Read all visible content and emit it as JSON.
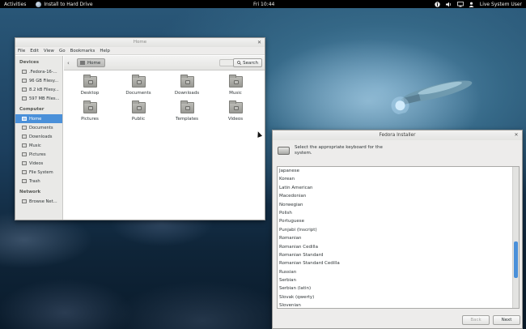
{
  "topbar": {
    "activities": "Activities",
    "app_name": "Install to Hard Drive",
    "clock": "Fri 10:44",
    "user": "Live System User",
    "icons": [
      "accessibility-icon",
      "volume-icon",
      "network-icon",
      "user-icon"
    ]
  },
  "file_manager": {
    "title": "Home",
    "menu": [
      "File",
      "Edit",
      "View",
      "Go",
      "Bookmarks",
      "Help"
    ],
    "sidebar": {
      "devices_heading": "Devices",
      "devices": [
        ".Fedora-16-...",
        "96 GB Filesy...",
        "8.2 kB Filesy...",
        "597 MB Files..."
      ],
      "computer_heading": "Computer",
      "computer": [
        "Home",
        "Documents",
        "Downloads",
        "Music",
        "Pictures",
        "Videos",
        "File System",
        "Trash"
      ],
      "network_heading": "Network",
      "network": [
        "Browse Net..."
      ]
    },
    "path": "Home",
    "search_label": "Search",
    "folders": [
      "Desktop",
      "Documents",
      "Downloads",
      "Music",
      "Pictures",
      "Public",
      "Templates",
      "Videos"
    ]
  },
  "installer": {
    "title": "Fedora Installer",
    "prompt": "Select the appropriate keyboard for the system.",
    "layouts": [
      "Japanese",
      "Korean",
      "Latin American",
      "Macedonian",
      "Norwegian",
      "Polish",
      "Portuguese",
      "Punjabi (Inscript)",
      "Romanian",
      "Romanian Cedilla",
      "Romanian Standard",
      "Romanian Standard Cedilla",
      "Russian",
      "Serbian",
      "Serbian (latin)",
      "Slovak (qwerty)",
      "Slovenian"
    ],
    "back_label": "Back",
    "next_label": "Next"
  },
  "colors": {
    "selection": "#4a90d9",
    "topbar": "#000000"
  }
}
